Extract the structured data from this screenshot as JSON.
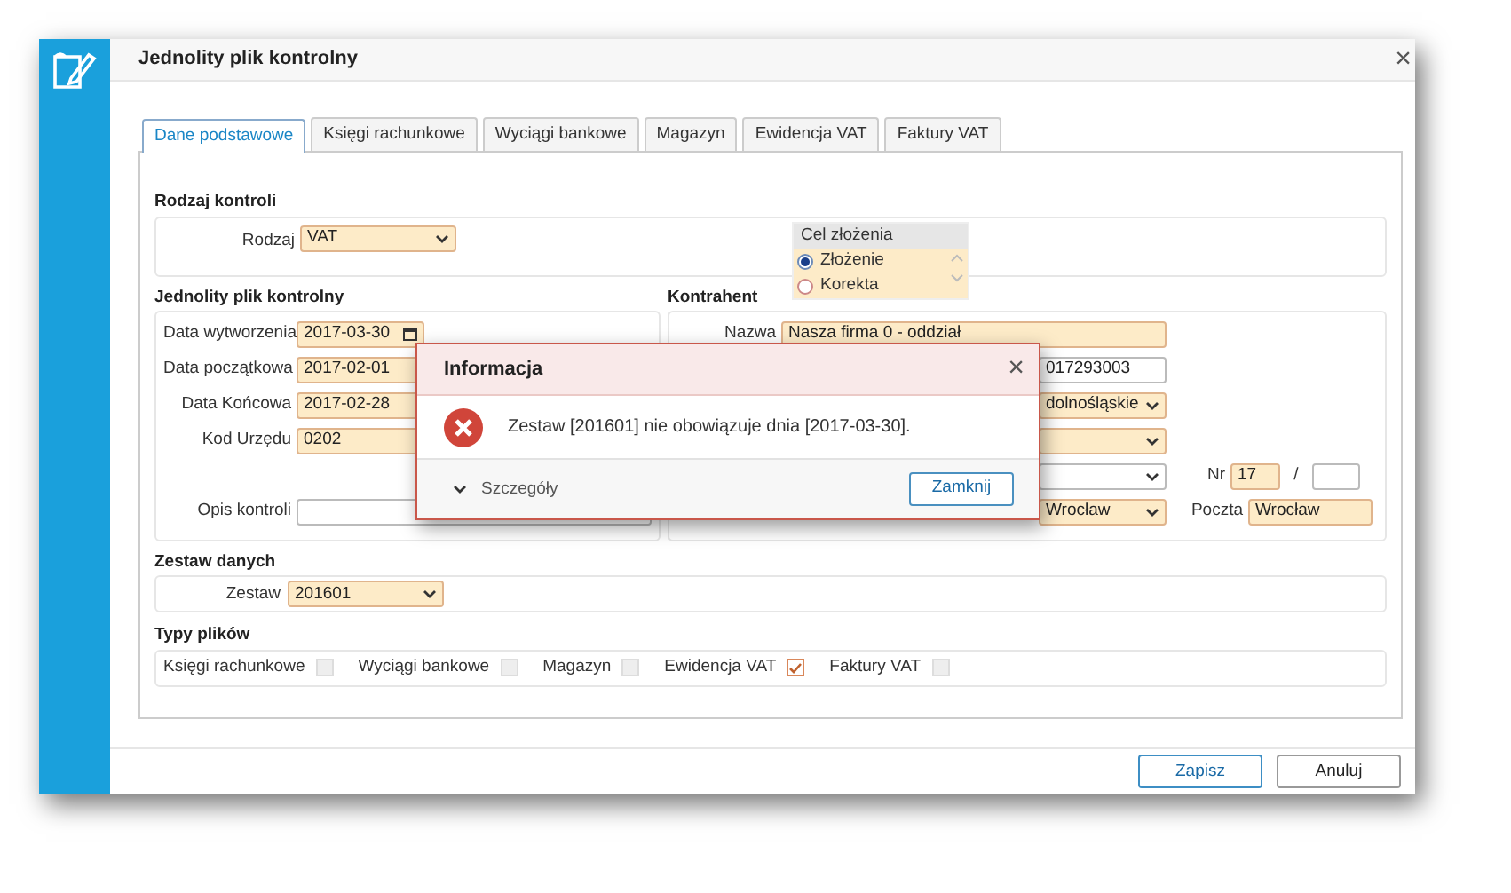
{
  "window": {
    "title": "Jednolity plik kontrolny",
    "close": "×"
  },
  "tabs": [
    {
      "label": "Dane podstawowe",
      "selected": true
    },
    {
      "label": "Księgi rachunkowe",
      "selected": false
    },
    {
      "label": "Wyciągi bankowe",
      "selected": false
    },
    {
      "label": "Magazyn",
      "selected": false
    },
    {
      "label": "Ewidencja VAT",
      "selected": false
    },
    {
      "label": "Faktury VAT",
      "selected": false
    }
  ],
  "rodzaj_kontroli": {
    "heading": "Rodzaj kontroli",
    "label": "Rodzaj",
    "value": "VAT",
    "cel": {
      "heading": "Cel złożenia",
      "options": [
        {
          "label": "Złożenie",
          "selected": true
        },
        {
          "label": "Korekta",
          "selected": false
        }
      ]
    }
  },
  "jpk": {
    "heading": "Jednolity plik kontrolny",
    "fields": [
      {
        "label": "Data wytworzenia",
        "value": "2017-03-30",
        "kind": "date",
        "required": true
      },
      {
        "label": "Data początkowa",
        "value": "2017-02-01",
        "kind": "text",
        "required": true
      },
      {
        "label": "Data Końcowa",
        "value": "2017-02-28",
        "kind": "text",
        "required": true
      },
      {
        "label": "Kod Urzędu",
        "value": "0202",
        "kind": "text",
        "required": true
      },
      {
        "label": "Opis kontroli",
        "kind": "text",
        "required": false
      }
    ]
  },
  "kontrahent": {
    "heading": "Kontrahent",
    "rows": [
      {
        "label": "Nazwa",
        "value": "Nasza firma 0 - oddział",
        "kind": "text",
        "required": true
      },
      {
        "value": "017293003",
        "kind": "text",
        "required": false
      },
      {
        "value": "dolnośląskie",
        "kind": "select",
        "required": true
      },
      {
        "kind": "select",
        "required": true
      },
      {
        "kind": "select",
        "required": false,
        "nr_label": "Nr",
        "nr_value": "17",
        "nr_required": true,
        "slash": "/"
      },
      {
        "value": "Wrocław",
        "kind": "select",
        "required": true,
        "poczta_label": "Poczta",
        "poczta_value": "Wrocław",
        "poczta_required": true
      }
    ]
  },
  "zestaw": {
    "heading": "Zestaw danych",
    "label": "Zestaw",
    "value": "201601"
  },
  "typy_plikow": {
    "heading": "Typy plików",
    "items": [
      {
        "label": "Księgi rachunkowe",
        "checked": false
      },
      {
        "label": "Wyciągi bankowe",
        "checked": false
      },
      {
        "label": "Magazyn",
        "checked": false
      },
      {
        "label": "Ewidencja VAT",
        "checked": true
      },
      {
        "label": "Faktury VAT",
        "checked": false
      }
    ]
  },
  "dialog": {
    "title": "Informacja",
    "close": "×",
    "message": "Zestaw [201601] nie obowiązuje dnia [2017-03-30].",
    "details": "Szczegóły",
    "button": "Zamknij"
  },
  "footer_buttons": [
    {
      "label": "Zapisz",
      "kind": "primary"
    },
    {
      "label": "Anuluj",
      "kind": "default"
    }
  ]
}
